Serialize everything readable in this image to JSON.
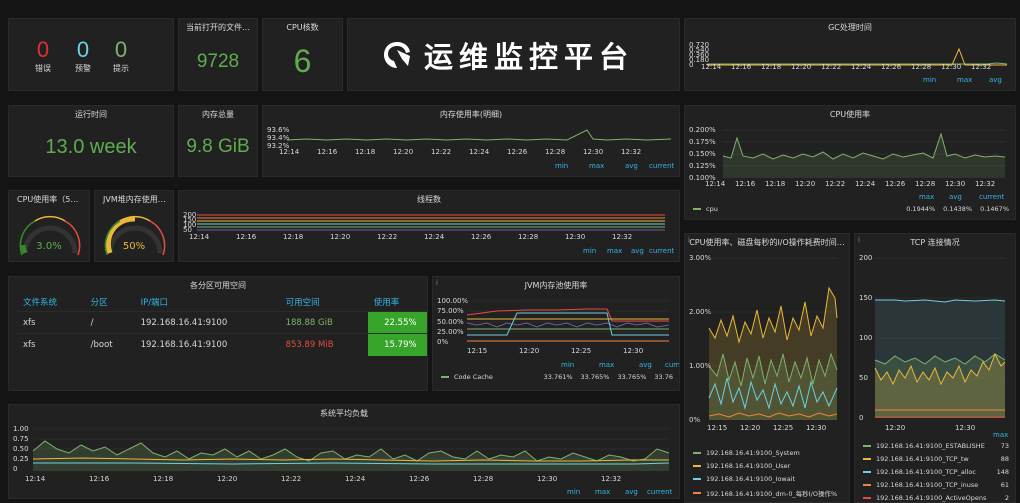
{
  "alerts": [
    {
      "value": "0",
      "label": "错误",
      "color": "#e02f2f"
    },
    {
      "value": "0",
      "label": "预警",
      "color": "#6ed0e0"
    },
    {
      "value": "0",
      "label": "提示",
      "color": "#7eb26d"
    }
  ],
  "open_files": {
    "title": "当前打开的文件…",
    "value": "9728"
  },
  "cpu_cores": {
    "title": "CPU核数",
    "value": "6"
  },
  "banner": {
    "title": "运维监控平台"
  },
  "gc": {
    "title": "GC处理时间",
    "yticks": [
      "0.720",
      "0.540",
      "0.360",
      "0.180",
      "0"
    ],
    "xticks": [
      "12:14",
      "12:16",
      "12:18",
      "12:20",
      "12:22",
      "12:24",
      "12:26",
      "12:28",
      "12:30",
      "12:32"
    ],
    "legend": [
      "min",
      "max",
      "avg"
    ]
  },
  "uptime": {
    "title": "运行时间",
    "value": "13.0 week"
  },
  "mem_total": {
    "title": "内存总量",
    "value": "9.8 GiB"
  },
  "mem_usage": {
    "title": "内存使用率(明细)",
    "yticks": [
      "93.6%",
      "93.4%",
      "93.2%"
    ],
    "xticks": [
      "12:14",
      "12:16",
      "12:18",
      "12:20",
      "12:22",
      "12:24",
      "12:26",
      "12:28",
      "12:30",
      "12:32"
    ],
    "legend": [
      "min",
      "max",
      "avg",
      "current"
    ]
  },
  "cpu_usage": {
    "title": "CPU使用率",
    "yticks": [
      "0.200%",
      "0.175%",
      "0.150%",
      "0.125%",
      "0.100%"
    ],
    "xticks": [
      "12:14",
      "12:16",
      "12:18",
      "12:20",
      "12:22",
      "12:24",
      "12:26",
      "12:28",
      "12:30",
      "12:32"
    ],
    "legend": [
      "max",
      "avg",
      "current"
    ],
    "series": {
      "name": "cpu",
      "max": "0.1944%",
      "avg": "0.1438%",
      "current": "0.1467%",
      "color": "#7eb26d"
    }
  },
  "cpu_gauge": {
    "title": "CPU使用率（5…",
    "value": "3.0%",
    "fraction": 0.03
  },
  "jvm_gauge": {
    "title": "JVM堆内存使用…",
    "value": "50%",
    "fraction": 0.5
  },
  "threads": {
    "title": "线程数",
    "yticks": [
      "200",
      "150",
      "100",
      "50"
    ],
    "xticks": [
      "12:14",
      "12:16",
      "12:18",
      "12:20",
      "12:22",
      "12:24",
      "12:26",
      "12:28",
      "12:30",
      "12:32"
    ],
    "legend": [
      "min",
      "max",
      "avg",
      "current"
    ]
  },
  "disk": {
    "title": "各分区可用空间",
    "headers": [
      "文件系统",
      "分区",
      "IP/端口",
      "可用空间",
      "使用率"
    ],
    "rows": [
      {
        "fs": "xfs",
        "mount": "/",
        "ip": "192.168.16.41:9100",
        "free": "188.88 GiB",
        "free_color": "#7eb26d",
        "pct": "22.55%"
      },
      {
        "fs": "xfs",
        "mount": "/boot",
        "ip": "192.168.16.41:9100",
        "free": "853.89 MiB",
        "free_color": "#e24d42",
        "pct": "15.79%"
      }
    ]
  },
  "jvm_pool": {
    "title": "JVM内存池使用率",
    "yticks": [
      "100.00%",
      "75.00%",
      "50.00%",
      "25.00%",
      "0%"
    ],
    "xticks": [
      "12:15",
      "12:20",
      "12:25",
      "12:30"
    ],
    "legend": [
      "min",
      "max",
      "avg",
      "cum"
    ],
    "series": {
      "name": "Code Cache",
      "min": "33.761%",
      "max": "33.765%",
      "avg": "33.765%",
      "cur": "33.76",
      "color": "#7eb26d"
    }
  },
  "io": {
    "title": "CPU使用率、磁盘每秒的I/O操作耗费时间…",
    "yticks": [
      "3.00%",
      "2.00%",
      "1.00%",
      "0%"
    ],
    "xticks": [
      "12:15",
      "12:20",
      "12:25",
      "12:30"
    ],
    "series": [
      {
        "name": "192.168.16.41:9100_System",
        "color": "#7eb26d"
      },
      {
        "name": "192.168.16.41:9100_User",
        "color": "#eab839"
      },
      {
        "name": "192.168.16.41:9100_Iowait",
        "color": "#6ed0e0"
      },
      {
        "name": "192.168.16.41:9100_dm-0_每秒I/O操作%",
        "color": "#ef843c"
      }
    ]
  },
  "tcp": {
    "title": "TCP 连接情况",
    "yticks": [
      "200",
      "150",
      "100",
      "50",
      "0"
    ],
    "xticks": [
      "12:20",
      "12:30"
    ],
    "legend_max": "max",
    "series": [
      {
        "name": "192.168.16.41:9100_ESTABLISHE",
        "max": "73",
        "color": "#7eb26d"
      },
      {
        "name": "192.168.16.41:9100_TCP_tw",
        "max": "88",
        "color": "#eab839"
      },
      {
        "name": "192.168.16.41:9100_TCP_alloc",
        "max": "148",
        "color": "#6ed0e0"
      },
      {
        "name": "192.168.16.41:9100_TCP_inuse",
        "max": "61",
        "color": "#ef843c"
      },
      {
        "name": "192.168.16.41:9100_ActiveOpens",
        "max": "2",
        "color": "#e24d42"
      }
    ]
  },
  "load": {
    "title": "系统平均负载",
    "yticks": [
      "1.00",
      "0.75",
      "0.50",
      "0.25",
      "0"
    ],
    "xticks": [
      "12:14",
      "12:16",
      "12:18",
      "12:20",
      "12:22",
      "12:24",
      "12:26",
      "12:28",
      "12:30",
      "12:32"
    ],
    "legend": [
      "min",
      "max",
      "avg",
      "current"
    ]
  }
}
